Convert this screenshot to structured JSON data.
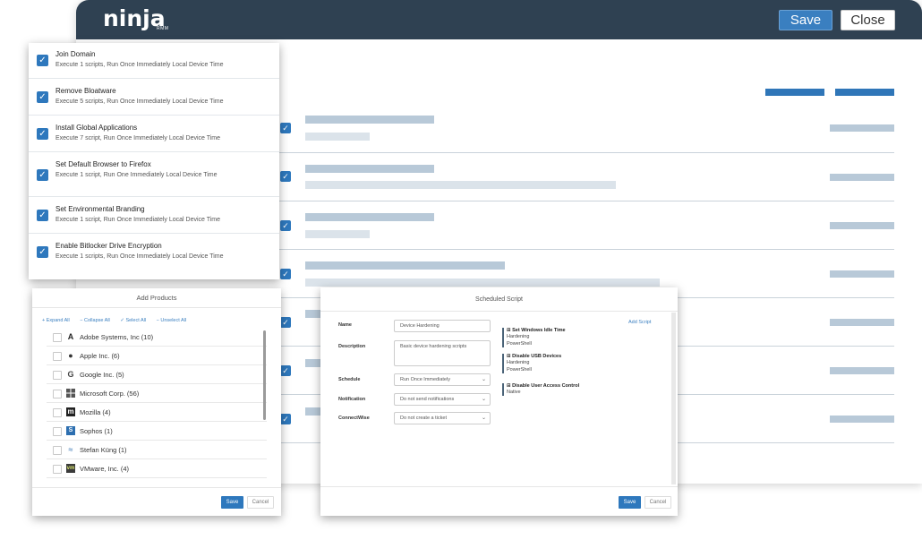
{
  "header": {
    "logo": "ninja",
    "logo_sub": "RMM",
    "save_label": "Save",
    "close_label": "Close"
  },
  "tasks": [
    {
      "title": "Join Domain",
      "subtitle": "Execute 1 scripts, Run Once Immediately Local Device Time",
      "checked": true
    },
    {
      "title": "Remove Bloatware",
      "subtitle": "Execute 5 scripts, Run Once Immediately Local Device Time",
      "checked": true
    },
    {
      "title": "Install Global Applications",
      "subtitle": "Execute 7 script, Run Once Immediately Local Device Time",
      "checked": true
    },
    {
      "title": "Set Default Browser to Firefox",
      "subtitle": "Execute 1 script, Run One Immediately Local Device Time",
      "checked": true
    },
    {
      "title": "Set Environmental Branding",
      "subtitle": "Execute 1 script, Run Once Immediately Local Device Time",
      "checked": true
    },
    {
      "title": "Enable Bitlocker Drive Encryption",
      "subtitle": "Execute 1 scripts, Run Once Immediately Local Device Time",
      "checked": true
    }
  ],
  "add_products": {
    "title": "Add Products",
    "actions": {
      "expand_all": "Expand All",
      "collapse_all": "Collapse All",
      "select_all": "Select All",
      "unselect_all": "Unselect All"
    },
    "items": [
      {
        "label": "Adobe Systems, Inc (10)",
        "icon": "adobe-icon"
      },
      {
        "label": "Apple Inc. (6)",
        "icon": "apple-icon"
      },
      {
        "label": "Google Inc. (5)",
        "icon": "google-icon"
      },
      {
        "label": "Microsoft Corp. (56)",
        "icon": "microsoft-icon"
      },
      {
        "label": "Mozilla (4)",
        "icon": "mozilla-icon"
      },
      {
        "label": "Sophos (1)",
        "icon": "sophos-icon"
      },
      {
        "label": "Stefan Küng (1)",
        "icon": "tortoise-icon"
      },
      {
        "label": "VMware, Inc. (4)",
        "icon": "vmware-icon"
      }
    ],
    "save_label": "Save",
    "cancel_label": "Cancel"
  },
  "scheduled_script": {
    "title": "Scheduled Script",
    "fields": {
      "name_label": "Name",
      "name_value": "Device Hardening",
      "description_label": "Description",
      "description_value": "Basic device hardening scripts",
      "schedule_label": "Schedule",
      "schedule_value": "Run Once Immediately",
      "notification_label": "Notification",
      "notification_value": "Do not send notifications",
      "connectwise_label": "ConnectWise",
      "connectwise_value": "Do not create a ticket"
    },
    "add_script_label": "Add Script",
    "scripts": [
      {
        "name": "Set Windows Idle Time",
        "category": "Hardening",
        "language": "PowerShell"
      },
      {
        "name": "Disable USB Devices",
        "category": "Hardening",
        "language": "PowerShell"
      },
      {
        "name": "Disable User Access Control",
        "language": "Native"
      }
    ],
    "save_label": "Save",
    "cancel_label": "Cancel"
  },
  "colors": {
    "topbar": "#2f4152",
    "accent": "#2e78bd",
    "placeholder": "#b8c9d8"
  }
}
